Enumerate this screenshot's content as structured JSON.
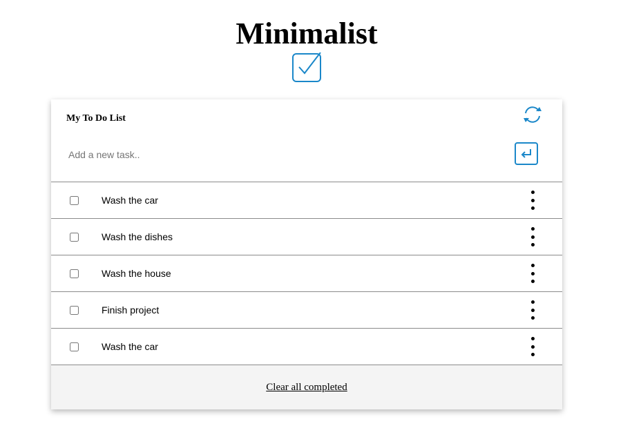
{
  "app": {
    "title": "Minimalist",
    "accent_color": "#1a87c9",
    "logo_icon": "checkbox-check-icon"
  },
  "card": {
    "list_title": "My To Do List",
    "refresh_icon": "refresh-icon",
    "input": {
      "placeholder": "Add a new task..",
      "value": ""
    },
    "enter_icon": "enter-return-icon"
  },
  "tasks": [
    {
      "label": "Wash the car",
      "checked": false
    },
    {
      "label": "Wash the dishes",
      "checked": false
    },
    {
      "label": "Wash the house",
      "checked": false
    },
    {
      "label": "Finish project",
      "checked": false
    },
    {
      "label": "Wash the car",
      "checked": false
    }
  ],
  "task_menu_icon": "more-vertical-icon",
  "footer": {
    "clear_label": "Clear all completed"
  }
}
